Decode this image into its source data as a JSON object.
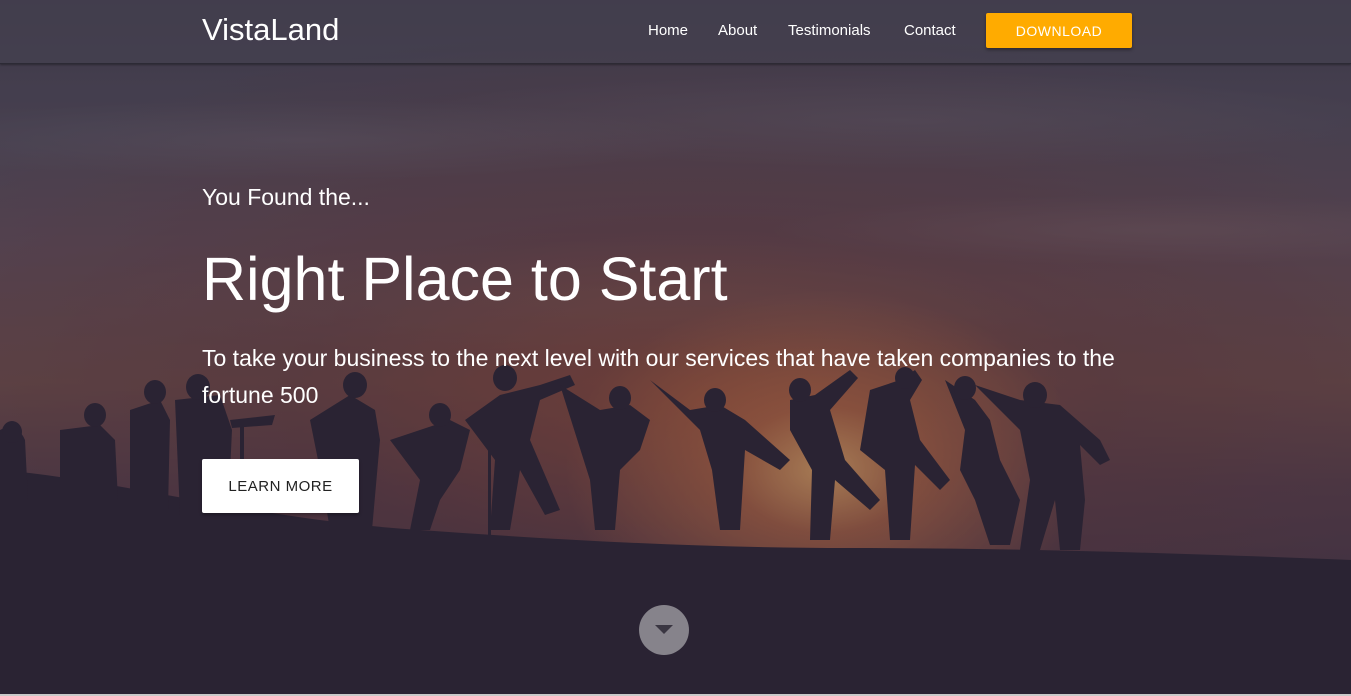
{
  "nav": {
    "brand": "VistaLand",
    "links": [
      "Home",
      "About",
      "Testimonials",
      "Contact"
    ],
    "download_label": "DOWNLOAD"
  },
  "hero": {
    "eyebrow": "You Found the...",
    "headline": "Right Place to Start",
    "subtext": "To take your business to the next level with our services that have taken companies to the fortune 500",
    "cta_label": "LEARN MORE",
    "scroll_icon": "chevron-down-icon"
  },
  "colors": {
    "accent": "#ffab00",
    "text": "#ffffff",
    "overlay": "#2a2234"
  }
}
